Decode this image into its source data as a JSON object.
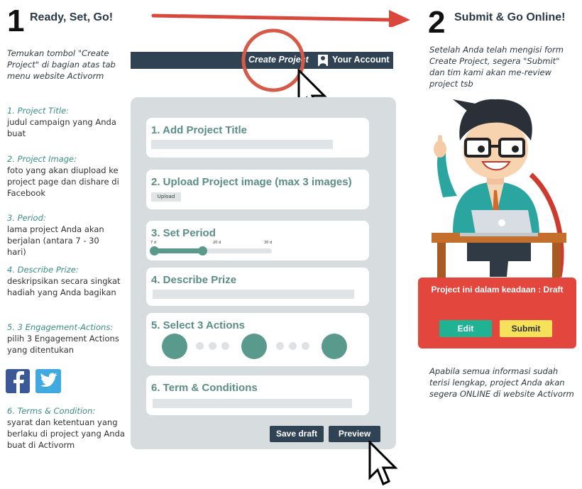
{
  "step1": {
    "number": "1",
    "title": "Ready, Set, Go!"
  },
  "step2": {
    "number": "2",
    "title": "Submit & Go Online!"
  },
  "intro_note": "Temukan tombol \"Create Project\" di bagian atas tab menu website Activorm",
  "submit_note": "Setelah Anda telah mengisi form Create Project, segera \"Submit\" dan tim kami akan me-review project tsb",
  "online_note": "Apabila semua informasi sudah terisi lengkap, project Anda akan segera ONLINE di website Activorm",
  "navbar": {
    "create_label": "Create Project",
    "account_label": "Your Account"
  },
  "sidebar": [
    {
      "title": "1. Project Title:",
      "desc": "judul campaign yang Anda  buat"
    },
    {
      "title": "2. Project Image:",
      "desc": "foto yang akan diupload ke project page dan dishare di Facebook"
    },
    {
      "title": "3. Period:",
      "desc": "lama project Anda akan berjalan (antara 7 - 30 hari)"
    },
    {
      "title": "4. Describe Prize:",
      "desc": "deskripsikan secara singkat hadiah yang Anda bagikan"
    },
    {
      "title": "5. 3 Engagement-Actions:",
      "desc": "pilih 3 Engagement Actions yang ditentukan"
    },
    {
      "title": "6. Terms & Condition:",
      "desc": "syarat dan ketentuan yang berlaku di project yang Anda buat di Activorm"
    }
  ],
  "form": {
    "card1": "1. Add Project Title",
    "card2": "2. Upload Project image (max 3 images)",
    "upload_label": "Upload",
    "card3": "3. Set Period",
    "period_ticks": [
      "7 d",
      "20 d",
      "30 d"
    ],
    "period_value": 20,
    "card4": "4. Describe Prize",
    "card5": "5. Select 3 Actions",
    "card6": "6. Term & Conditions",
    "save_draft": "Save draft",
    "preview": "Preview"
  },
  "status_box": {
    "text": "Project ini dalam keadaan : Draft",
    "edit": "Edit",
    "submit": "Submit"
  },
  "colors": {
    "navy": "#2f4355",
    "teal": "#5a9a8d",
    "red": "#e2463d",
    "yellow": "#f5e15a",
    "edit_teal": "#1fb394"
  }
}
